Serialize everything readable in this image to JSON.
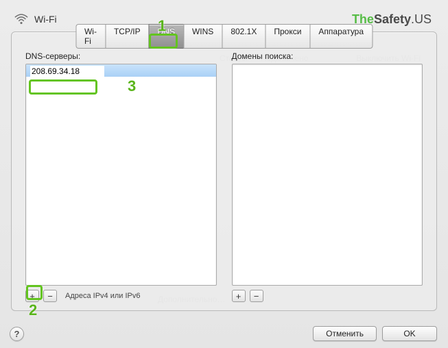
{
  "header": {
    "title": "Wi-Fi"
  },
  "brand": {
    "part1": "The",
    "part2": "Safety",
    "part3": ".US"
  },
  "tabs": [
    {
      "label": "Wi-Fi"
    },
    {
      "label": "TCP/IP"
    },
    {
      "label": "DNS"
    },
    {
      "label": "WINS"
    },
    {
      "label": "802.1X"
    },
    {
      "label": "Прокси"
    },
    {
      "label": "Аппаратура"
    }
  ],
  "active_tab_index": 2,
  "left": {
    "label": "DNS-серверы:",
    "entries": [
      "208.69.34.18"
    ],
    "add_glyph": "+",
    "remove_glyph": "−",
    "hint": "Адреса IPv4 или IPv6"
  },
  "right": {
    "label": "Домены поиска:",
    "add_glyph": "+",
    "remove_glyph": "−"
  },
  "footer": {
    "help_glyph": "?",
    "cancel": "Отменить",
    "ok": "OK"
  },
  "annotations": {
    "n1": "1",
    "n2": "2",
    "n3": "3"
  }
}
